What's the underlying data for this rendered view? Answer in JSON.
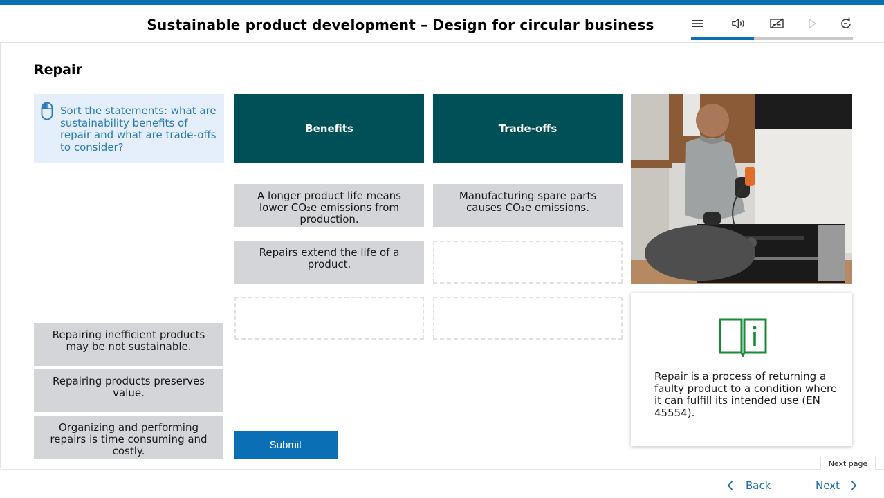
{
  "header": {
    "title": "Sustainable product development – Design for circular business",
    "progress_fraction": 0.39
  },
  "page": {
    "heading": "Repair",
    "instruction": "Sort the statements: what are sustainability benefits of repair and what are trade-offs to consider?"
  },
  "columns": {
    "benefits": "Benefits",
    "tradeoffs": "Trade-offs"
  },
  "placed": {
    "benefit_1": "A longer product life means lower CO₂e emissions from production.",
    "benefit_2": "Repairs extend the life of a product.",
    "tradeoff_1": "Manufacturing spare parts causes CO₂e emissions."
  },
  "pool": [
    "Repairing inefficient products may be not sustainable.",
    "Repairing products preserves value.",
    "Organizing and performing repairs is time consuming and costly."
  ],
  "info": {
    "text": "Repair is a process of returning a faulty product to a condition where it can fulfill its intended use (EN 45554)."
  },
  "submit_label": "Submit",
  "nav": {
    "back": "Back",
    "next": "Next",
    "tooltip": "Next page"
  },
  "icons": {
    "menu": "menu-icon",
    "audio": "speaker-icon",
    "captions": "captions-off-icon",
    "play": "play-icon",
    "restart": "restart-icon",
    "instruction": "mouse-icon",
    "info": "book-info-icon"
  },
  "colors": {
    "accent_blue": "#0a6fb5",
    "column_header": "#005058",
    "card": "#d3d5d8",
    "instruction_bg": "#e4effb",
    "instruction_text": "#2a7ab8",
    "info_icon": "#1a8a3a"
  }
}
